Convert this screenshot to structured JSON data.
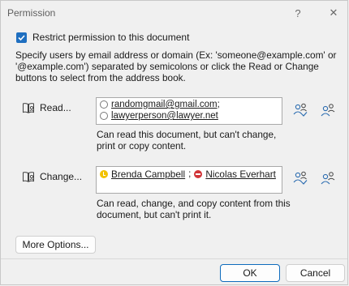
{
  "window": {
    "title": "Permission",
    "help_label": "?",
    "close_label": "✕"
  },
  "restrict": {
    "label": "Restrict permission to this document",
    "checked": true
  },
  "instructions": "Specify users by email address or domain (Ex: 'someone@example.com' or '@example.com') separated by semicolons or click the Read or Change buttons to select from the address book.",
  "read": {
    "button_label": "Read...",
    "entries": [
      {
        "email": "randomgmail@gmail.com",
        "sep": ";"
      },
      {
        "email": "lawyerperson@lawyer.net",
        "sep": ""
      }
    ],
    "description": "Can read this document, but can't change, print or copy content."
  },
  "change": {
    "button_label": "Change...",
    "people": [
      {
        "name": "Brenda Campbell",
        "status": "away",
        "sep": ";"
      },
      {
        "name": "Nicolas Everhart",
        "status": "busy",
        "sep": ""
      }
    ],
    "description": "Can read, change, and copy content from this document, but can't print it."
  },
  "buttons": {
    "more_options": "More Options...",
    "ok": "OK",
    "cancel": "Cancel"
  },
  "colors": {
    "accent": "#1f6fc0",
    "away": "#f2c200",
    "busy": "#d13438"
  },
  "icons": [
    "help-icon",
    "close-icon",
    "address-book-icon",
    "check-names-icon",
    "add-people-icon"
  ]
}
